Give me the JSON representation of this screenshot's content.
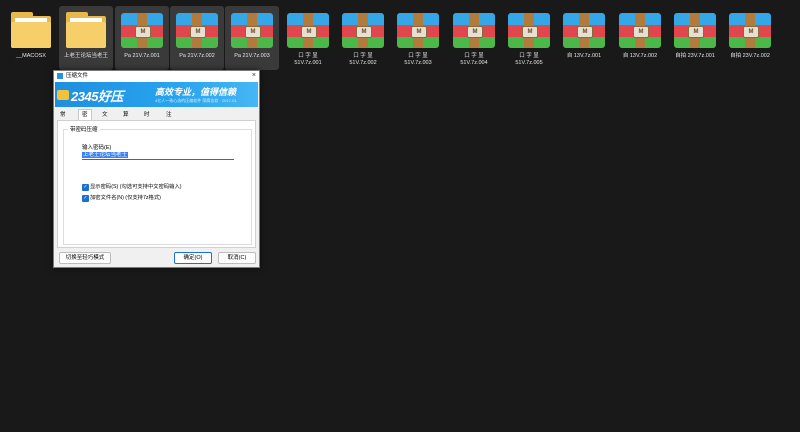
{
  "desktop": {
    "files": [
      {
        "label": "__MACOSX",
        "type": "folder",
        "selected": false
      },
      {
        "label": "上老王论坛当老王",
        "type": "folder",
        "selected": true
      },
      {
        "label": "Pa 21V.7z.001",
        "type": "archive",
        "selected": true
      },
      {
        "label": "Pa 21V.7z.002",
        "type": "archive",
        "selected": true
      },
      {
        "label": "Pa 21V.7z.003",
        "type": "archive",
        "selected": true
      },
      {
        "label": "口 字 显\n51V.7z.001",
        "type": "archive",
        "selected": false
      },
      {
        "label": "口 字 显\n51V.7z.002",
        "type": "archive",
        "selected": false
      },
      {
        "label": "口 字 显\n51V.7z.003",
        "type": "archive",
        "selected": false
      },
      {
        "label": "口 字 显\n51V.7z.004",
        "type": "archive",
        "selected": false
      },
      {
        "label": "口 字 显\n51V.7z.005",
        "type": "archive",
        "selected": false
      },
      {
        "label": "自 13V.7z.001",
        "type": "archive",
        "selected": false
      },
      {
        "label": "自 13V.7z.002",
        "type": "archive",
        "selected": false
      },
      {
        "label": "自拍 23V.7z.001",
        "type": "archive",
        "selected": false
      },
      {
        "label": "自拍 23V.7z.002",
        "type": "archive",
        "selected": false
      }
    ],
    "archive_buckle": "M"
  },
  "dialog": {
    "title": "压缩文件",
    "close_glyph": "×",
    "banner": {
      "logo": "2345好压",
      "slogan": "高效专业，值得信赖",
      "subtitle": "4亿人一致心选的压缩软件  荣膺佳软 · 2017-01"
    },
    "tabs": [
      "常规",
      "密码",
      "文件",
      "算法",
      "时间",
      "注释"
    ],
    "active_tab": "密码",
    "group_title": "带密码压缩",
    "password_label": "输入密码(E)",
    "password_value": "上老王论坛当老王",
    "checkboxes": [
      {
        "label": "显示密码(S)   (勾选可支持中文密码输入)",
        "checked": true
      },
      {
        "label": "加密文件名(N)   (仅支持7z格式)",
        "checked": true
      }
    ],
    "buttons": {
      "simple_mode": "切换至轻巧模式",
      "ok": "确定(O)",
      "cancel": "取消(C)"
    },
    "colors": {
      "accent": "#1a6fd0",
      "banner": "#28a4ef"
    }
  }
}
